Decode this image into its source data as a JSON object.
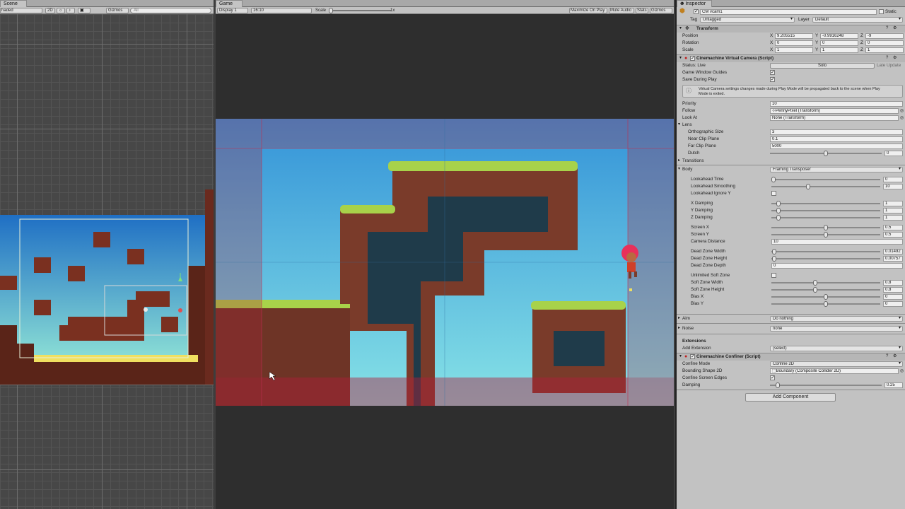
{
  "scene": {
    "tab_label": "Scene",
    "shading_mode": "haded",
    "mode_2d": "2D",
    "gizmos_label": "Gizmos",
    "search_placeholder": "All"
  },
  "game": {
    "tab_label": "Game",
    "display": "Display 1",
    "aspect": "16:10",
    "scale_label": "Scale",
    "scale_value": "1x",
    "maximize_on_play": "Maximize On Play",
    "mute_audio": "Mute Audio",
    "stats": "Stats",
    "gizmos": "Gizmos"
  },
  "inspector": {
    "tab_label": "Inspector",
    "object_name": "CM vcam1",
    "static_label": "Static",
    "tag_label": "Tag",
    "tag_value": "Untagged",
    "layer_label": "Layer",
    "layer_value": "Default",
    "transform": {
      "title": "Transform",
      "position_label": "Position",
      "rotation_label": "Rotation",
      "scale_label": "Scale",
      "position": [
        "9.205515",
        "-0.9916248",
        "-9"
      ],
      "rotation": [
        "0",
        "0",
        "0"
      ],
      "scale": [
        "1",
        "1",
        "1"
      ]
    },
    "vcam": {
      "title": "Cinemachine Virtual Camera (Script)",
      "status_label": "Status: Live",
      "solo_button": "Solo",
      "late_update": "Late Update",
      "game_window_guides": "Game Window Guides",
      "save_during_play": "Save During Play",
      "info_text_1": "Virtual Camera settings changes made during Play Mode will be propagated back to the scene when Play",
      "info_text_2": "Mode is exited.",
      "priority_label": "Priority",
      "priority_value": "10",
      "follow_label": "Follow",
      "follow_value": "PennyPixel (Transform)",
      "look_at_label": "Look At",
      "look_at_value": "None (Transform)",
      "lens_label": "Lens",
      "ortho_size_label": "Orthographic Size",
      "ortho_size_value": "3",
      "near_clip_label": "Near Clip Plane",
      "near_clip_value": "0.1",
      "far_clip_label": "Far Clip Plane",
      "far_clip_value": "5000",
      "dutch_label": "Dutch",
      "dutch_value": "0",
      "transitions_label": "Transitions",
      "body_label": "Body",
      "body_value": "Framing Transposer",
      "body_props": [
        {
          "label": "Lookahead Time",
          "value": "0",
          "level": 0.0
        },
        {
          "label": "Lookahead Smoothing",
          "value": "10",
          "level": 0.33
        },
        {
          "label": "Lookahead Ignore Y",
          "check": true
        },
        {
          "label": "X Damping",
          "value": "1",
          "level": 0.05
        },
        {
          "label": "Y Damping",
          "value": "1",
          "level": 0.05
        },
        {
          "label": "Z Damping",
          "value": "1",
          "level": 0.05
        },
        {
          "label": "Screen X",
          "value": "0.5",
          "level": 0.5
        },
        {
          "label": "Screen Y",
          "value": "0.5",
          "level": 0.5
        },
        {
          "label": "Camera Distance",
          "value": "10",
          "field": true
        },
        {
          "label": "Dead Zone Width",
          "value": "0.01492",
          "level": 0.01
        },
        {
          "label": "Dead Zone Height",
          "value": "0.00757",
          "level": 0.01
        },
        {
          "label": "Dead Zone Depth",
          "value": "0",
          "field": true
        },
        {
          "label": "Unlimited Soft Zone",
          "check": true
        },
        {
          "label": "Soft Zone Width",
          "value": "0.8",
          "level": 0.4
        },
        {
          "label": "Soft Zone Height",
          "value": "0.8",
          "level": 0.4
        },
        {
          "label": "Bias X",
          "value": "0",
          "level": 0.5
        },
        {
          "label": "Bias Y",
          "value": "0",
          "level": 0.5
        }
      ],
      "aim_label": "Aim",
      "aim_value": "Do nothing",
      "noise_label": "Noise",
      "noise_value": "none",
      "extensions_label": "Extensions",
      "add_extension_label": "Add Extension",
      "add_extension_value": "(select)"
    },
    "confiner": {
      "title": "Cinemachine Confiner (Script)",
      "mode_label": "Confine Mode",
      "mode_value": "Confine 2D",
      "bounding_label": "Bounding Shape 2D",
      "bounding_value": "Boundary (Composite Collider 2D)",
      "confine_edges_label": "Confine Screen Edges",
      "damping_label": "Damping",
      "damping_value": "0.25",
      "damping_level": 0.05
    },
    "add_component": "Add Component"
  },
  "colors": {
    "sky_top": "#3a8ed6",
    "sky_bottom": "#7ee0e8",
    "grass": "#a8d24a",
    "rock": "#7a3b2a",
    "rock_dark": "#1e3a48",
    "overlay_red": "#b0203a"
  }
}
